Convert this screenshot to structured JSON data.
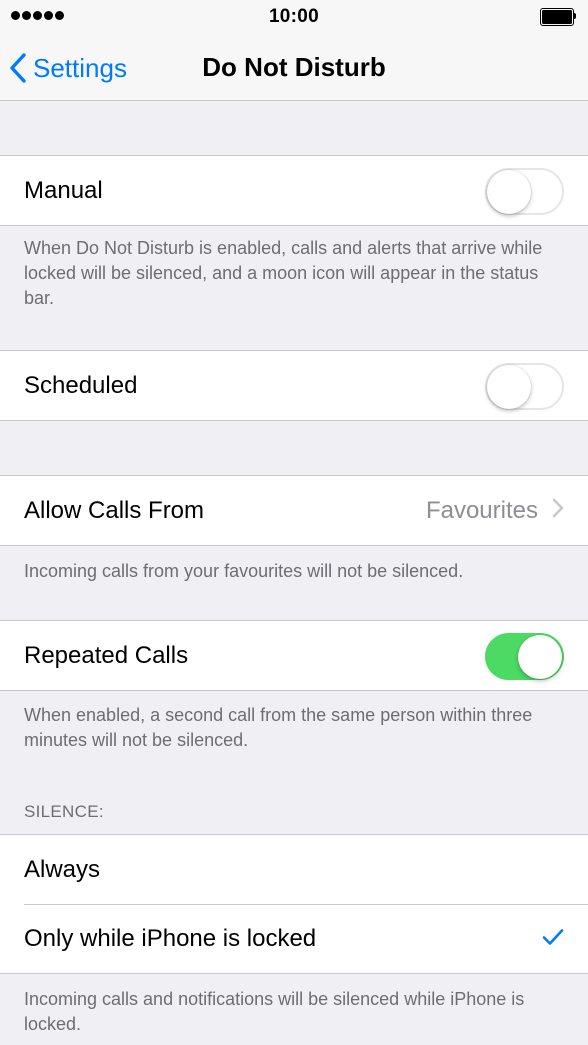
{
  "status_bar": {
    "time": "10:00",
    "signal_icon": "signal-dots-icon",
    "battery_icon": "battery-icon"
  },
  "nav": {
    "back_label": "Settings",
    "back_icon": "chevron-left-icon",
    "title": "Do Not Disturb"
  },
  "manual": {
    "label": "Manual",
    "enabled": false,
    "footer": "When Do Not Disturb is enabled, calls and alerts that arrive while locked will be silenced, and a moon icon will appear in the status bar."
  },
  "scheduled": {
    "label": "Scheduled",
    "enabled": false
  },
  "allow_calls": {
    "label": "Allow Calls From",
    "value": "Favourites",
    "chevron_icon": "chevron-right-icon",
    "footer": "Incoming calls from your favourites will not be silenced."
  },
  "repeated_calls": {
    "label": "Repeated Calls",
    "enabled": true,
    "footer": "When enabled, a second call from the same person within three minutes will not be silenced."
  },
  "silence": {
    "header": "SILENCE:",
    "options": [
      {
        "label": "Always",
        "selected": false
      },
      {
        "label": "Only while iPhone is locked",
        "selected": true
      }
    ],
    "check_icon": "checkmark-icon",
    "footer": "Incoming calls and notifications will be silenced while iPhone is locked."
  },
  "colors": {
    "accent": "#007aff",
    "toggle_on": "#4cd964",
    "background": "#efeff4",
    "secondary_text": "#6d6d72"
  }
}
